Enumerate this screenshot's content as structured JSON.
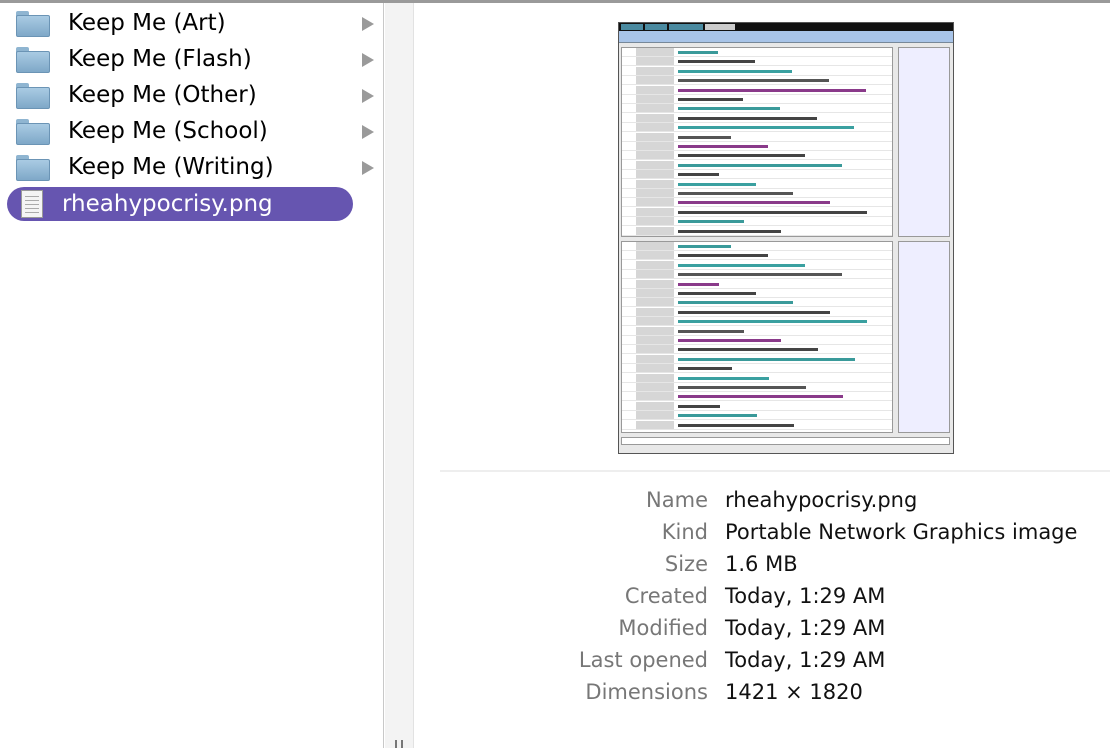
{
  "column": {
    "items": [
      {
        "name": "Keep Me (Art)",
        "type": "folder"
      },
      {
        "name": "Keep Me (Flash)",
        "type": "folder"
      },
      {
        "name": "Keep Me (Other)",
        "type": "folder"
      },
      {
        "name": "Keep Me (School)",
        "type": "folder"
      },
      {
        "name": "Keep Me (Writing)",
        "type": "folder"
      },
      {
        "name": "rheahypocrisy.png",
        "type": "file",
        "selected": true
      }
    ]
  },
  "colors": {
    "selection": "#6655b0",
    "folder": "#8fb5d1"
  },
  "info": {
    "rows": [
      {
        "label": "Name",
        "value": "rheahypocrisy.png"
      },
      {
        "label": "Kind",
        "value": "Portable Network Graphics image"
      },
      {
        "label": "Size",
        "value": "1.6 MB"
      },
      {
        "label": "Created",
        "value": "Today, 1:29 AM"
      },
      {
        "label": "Modified",
        "value": "Today, 1:29 AM"
      },
      {
        "label": "Last opened",
        "value": "Today, 1:29 AM"
      },
      {
        "label": "Dimensions",
        "value": "1421 × 1820"
      }
    ]
  }
}
